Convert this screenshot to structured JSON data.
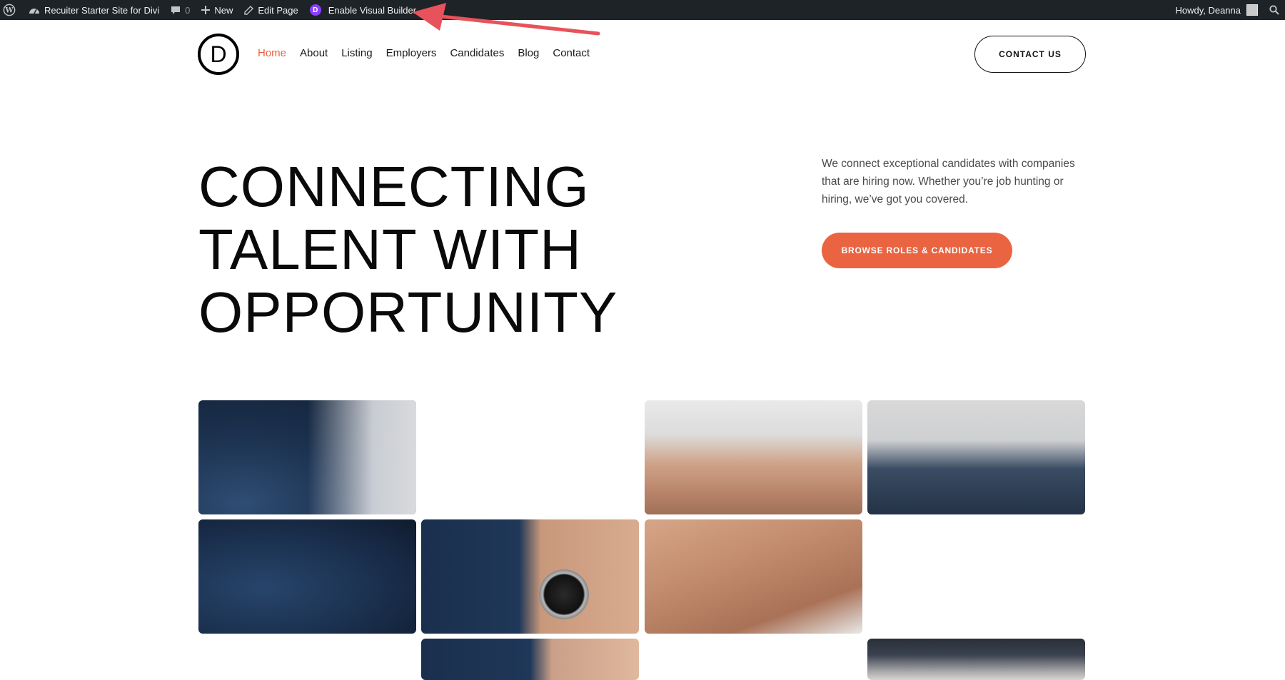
{
  "admin_bar": {
    "site_name": "Recuiter Starter Site for Divi",
    "comments_count": "0",
    "new_label": "New",
    "edit_page_label": "Edit Page",
    "visual_builder_label": "Enable Visual Builder",
    "visual_builder_badge": "D",
    "greeting": "Howdy, Deanna",
    "icons": [
      "wordpress-icon",
      "dashboard-icon",
      "comment-icon",
      "plus-icon",
      "pencil-icon",
      "divi-icon",
      "avatar",
      "search-icon"
    ]
  },
  "header": {
    "logo_letter": "D",
    "nav": [
      {
        "label": "Home",
        "active": true
      },
      {
        "label": "About"
      },
      {
        "label": "Listing"
      },
      {
        "label": "Employers"
      },
      {
        "label": "Candidates"
      },
      {
        "label": "Blog"
      },
      {
        "label": "Contact"
      }
    ],
    "contact_button": "CONTACT US"
  },
  "hero": {
    "title_line1": "CONNECTING",
    "title_line2": "TALENT WITH",
    "title_line3": "OPPORTUNITY",
    "description": "We connect exceptional candidates with companies that are hiring now. Whether you’re job hunting or hiring, we’ve got you covered.",
    "cta_button": "BROWSE ROLES & CANDIDATES"
  },
  "gallery": {
    "tiles": [
      {
        "name": "suit-jacket-image"
      },
      {
        "name": "handshake-image"
      },
      {
        "name": "suit-sleeve-image"
      },
      {
        "name": "suit-fabric-image"
      },
      {
        "name": "wristwatch-image"
      },
      {
        "name": "handshake-closeup-image"
      },
      {
        "name": "wristwatch-hand-image"
      },
      {
        "name": "desk-image"
      }
    ]
  },
  "colors": {
    "accent": "#ea6442",
    "admin_bar_bg": "#1d2327",
    "annotation_arrow": "#e8525a",
    "divi_purple": "#8a3ffc"
  }
}
